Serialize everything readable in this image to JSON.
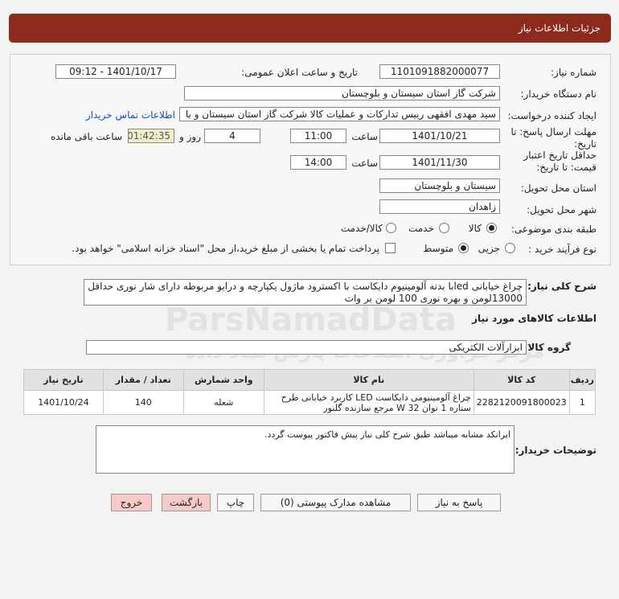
{
  "title": "جزئیات اطلاعات نیاز",
  "need_number": {
    "label": "شماره نیاز:",
    "value": "1101091882000077"
  },
  "announce": {
    "label": "تاریخ و ساعت اعلان عمومی:",
    "value": "1401/10/17 - 09:12"
  },
  "buyer": {
    "label": "نام دستگاه خریدار:",
    "value": "شرکت گاز استان سیستان و بلوچستان"
  },
  "requester": {
    "label": "ایجاد کننده درخواست:",
    "value": "سید مهدی افقهی رییس تدارکات و عملیات کالا شرکت گاز استان سیستان و با",
    "contact_link": "اطلاعات تماس خریدار"
  },
  "deadline": {
    "label_line1": "مهلت ارسال پاسخ: تا",
    "label_line2": "تاریخ:",
    "date": "1401/10/21",
    "time_label": "ساعت",
    "time": "11:00",
    "days": "4",
    "days_label": "روز و",
    "remaining": "01:42:35",
    "remaining_label": "ساعت باقی مانده"
  },
  "validity": {
    "label_line1": "حداقل تاریخ اعتبار",
    "label_line2": "قیمت: تا تاریخ:",
    "date": "1401/11/30",
    "time_label": "ساعت",
    "time": "14:00"
  },
  "province": {
    "label": "استان محل تحویل:",
    "value": "سیستان و بلوچستان"
  },
  "city": {
    "label": "شهر محل تحویل:",
    "value": "زاهدان"
  },
  "category": {
    "label": "طبقه بندی موضوعی:",
    "options": [
      "کالا",
      "خدمت",
      "کالا/خدمت"
    ],
    "selected": "کالا"
  },
  "process": {
    "label": "نوع فرآیند خرید :",
    "options": [
      "جزیی",
      "متوسط"
    ],
    "selected": "متوسط",
    "payment_note": "پرداخت تمام یا بخشی از مبلغ خرید،از محل \"اسناد خزانه اسلامی\" خواهد بود."
  },
  "summary": {
    "label": "شرح کلی نیاز:",
    "value": "چراغ خیابانی ledبا بدنه آلومینیوم دایکاست با اکسترود ماژول یکپارچه و درایو مربوطه دارای شار نوری حداقل 13000لومن و بهره نوری 100 لومن بر وات"
  },
  "goods_info_title": "اطلاعات کالاهای مورد نیاز",
  "goods_group": {
    "label": "گروه کالا:",
    "value": "ابزارآلات الکتریکی"
  },
  "table": {
    "headers": [
      "ردیف",
      "کد کالا",
      "نام کالا",
      "واحد شمارش",
      "تعداد / مقدار",
      "تاریخ نیاز"
    ],
    "rows": [
      {
        "row": "1",
        "code": "2282120091800023",
        "name": "چراغ آلومینیومی دایکاست LED کاربرد خیابانی طرح ستاره 1 توان W 32 مرجع سازنده گلنور",
        "unit": "شعله",
        "qty": "140",
        "date": "1401/10/24"
      }
    ]
  },
  "buyer_notes": {
    "label": "توضیحات خریدار:",
    "value": "ایرانکد مشابه میباشد طبق شرح کلی نیاز پیش فاکتور پیوست گردد."
  },
  "buttons": {
    "reply": "پاسخ به نیاز",
    "attachments": "مشاهده مدارک پیوستی (0)",
    "print": "چاپ",
    "back": "بازگشت",
    "exit": "خروج"
  },
  "watermark": {
    "brand": "ParsNamadData",
    "line1": "مرکز فرآوری اطلاعات پارس نماد داده",
    "line2": "پایگاه اطلاع رسانی مناقصه و مزایده",
    "phone": "۰۲۱-۸۸۳۴۹۶۷۰"
  }
}
